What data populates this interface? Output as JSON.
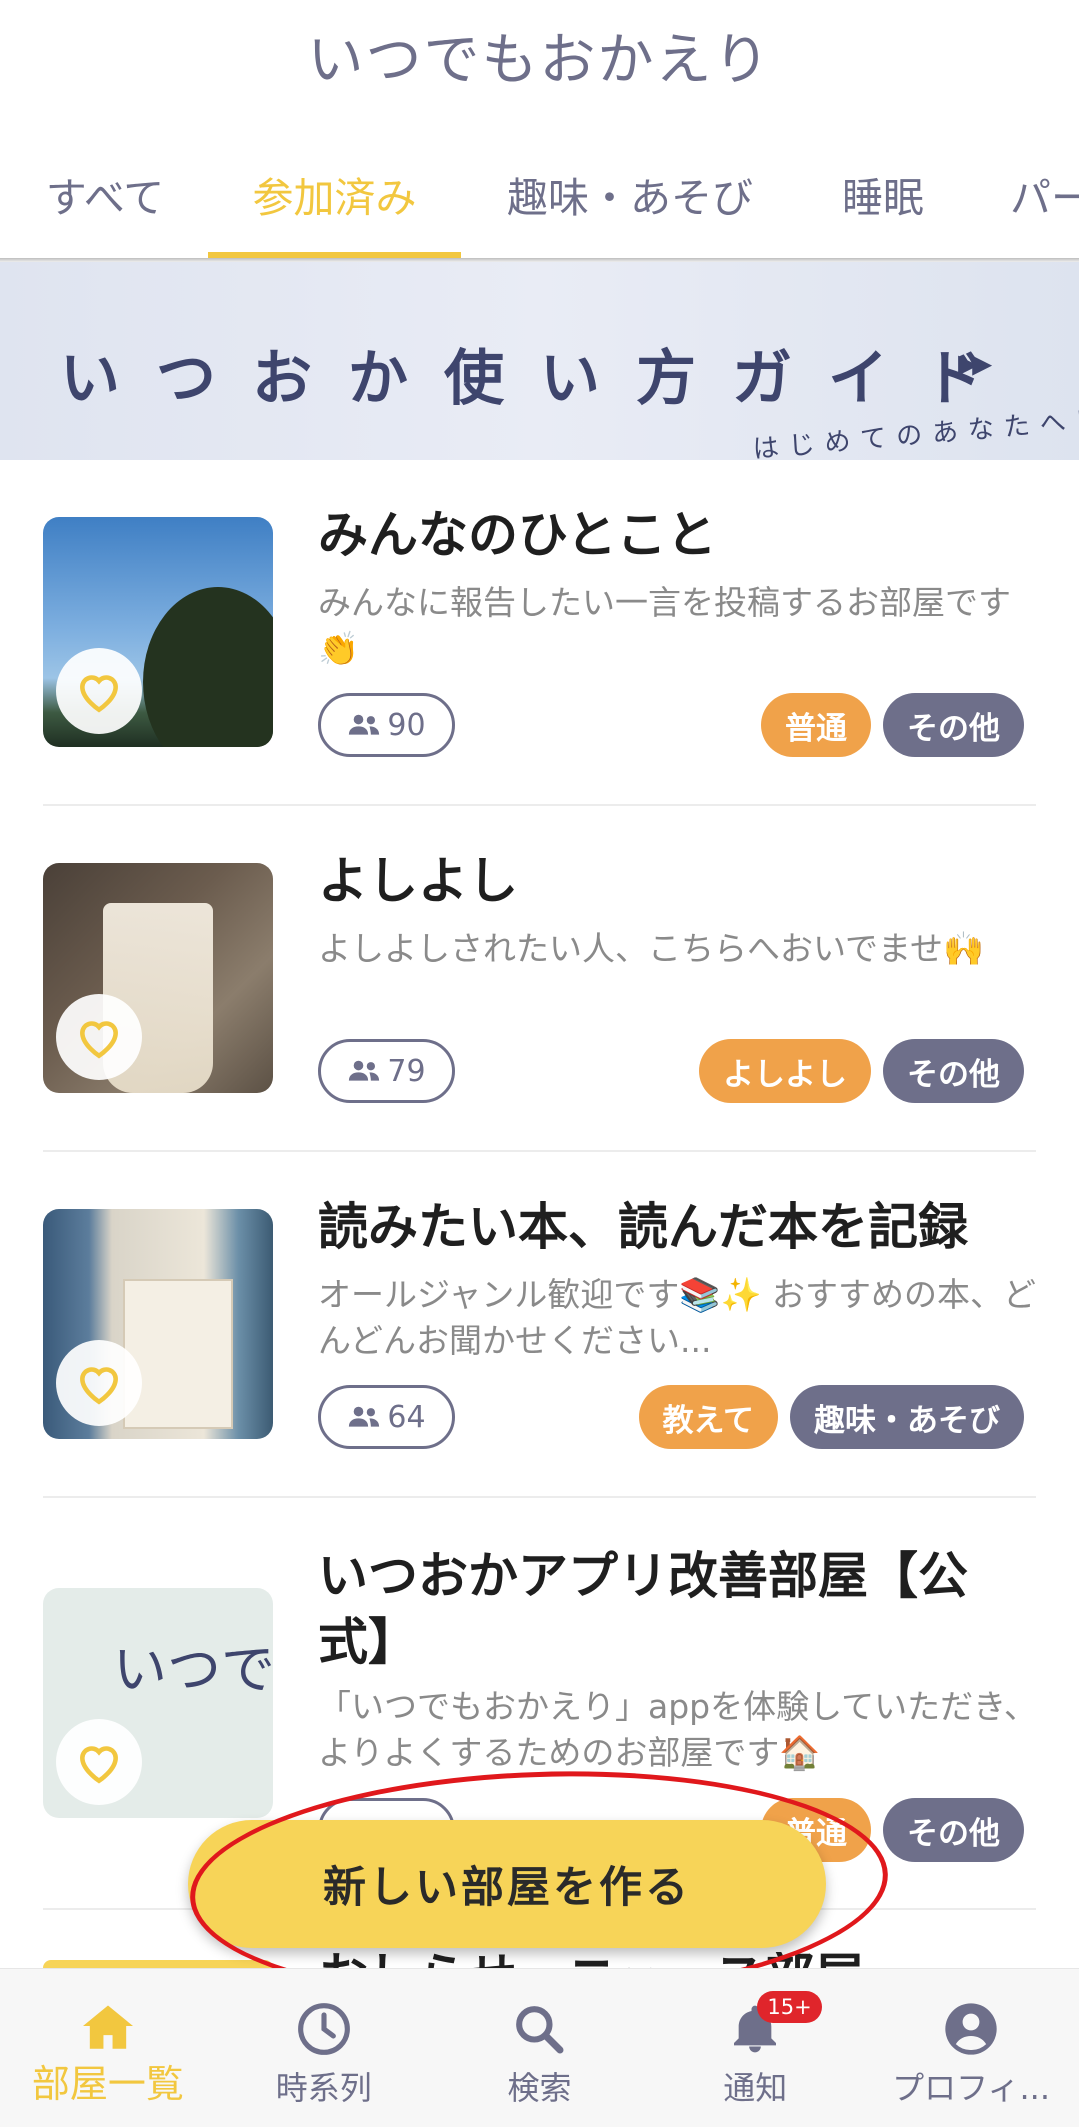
{
  "app_title": "いつでもおかえり",
  "tabs": [
    {
      "label": "すべて"
    },
    {
      "label": "参加済み"
    },
    {
      "label": "趣味・あそび"
    },
    {
      "label": "睡眠"
    },
    {
      "label": "パー"
    }
  ],
  "banner": {
    "title": "いつおか使い方ガイド",
    "arrow": "▸▸",
    "subtitle": "はじめてのあなたへ!"
  },
  "rooms": [
    {
      "name": "みんなのひとこと",
      "description": "みんなに報告したい一言を投稿するお部屋です👏",
      "members": "90",
      "tags": [
        "普通",
        "その他"
      ]
    },
    {
      "name": "よしよし",
      "description": "よしよしされたい人、こちらへおいでませ🙌",
      "members": "79",
      "tags": [
        "よしよし",
        "その他"
      ]
    },
    {
      "name": "読みたい本、読んだ本を記録",
      "description": "オールジャンル歓迎です📚✨ おすすめの本、どんどんお聞かせください...",
      "members": "64",
      "tags": [
        "教えて",
        "趣味・あそび"
      ]
    },
    {
      "name": "いつおかアプリ改善部屋【公式】",
      "description": "「いつでもおかえり」appを体験していただき、よりよくするためのお部屋です🏠",
      "thumb_text": "いつでも おかえり",
      "members": "",
      "tags": [
        "普通",
        "その他"
      ]
    },
    {
      "name": "おしらせ・ニュース部屋【公式】"
    }
  ],
  "fab_label": "新しい部屋を作る",
  "bottom_nav": [
    {
      "label": "部屋一覧",
      "icon": "home-icon"
    },
    {
      "label": "時系列",
      "icon": "clock-icon"
    },
    {
      "label": "検索",
      "icon": "search-icon"
    },
    {
      "label": "通知",
      "icon": "bell-icon",
      "badge": "15+"
    },
    {
      "label": "プロフィ...",
      "icon": "account-icon"
    }
  ],
  "colors": {
    "accent": "#f2c73f",
    "tag_orange": "#f0a24a",
    "tag_gray": "#6e6f8a",
    "annotation_red": "#e0181c"
  }
}
